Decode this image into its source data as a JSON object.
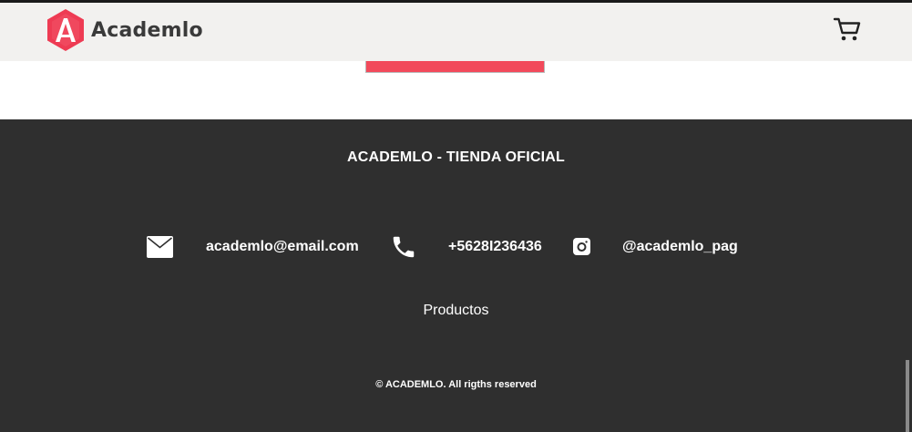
{
  "navbar": {
    "brand": "Academlo",
    "logo_icon": "academlo-logo-icon",
    "cart_icon": "cart-icon"
  },
  "colors": {
    "accent": "#f24a5b",
    "footer_bg": "#2f2f2f",
    "navbar_bg": "#f2f1ef"
  },
  "footer": {
    "title": "ACADEMLO - TIENDA OFICIAL",
    "contacts": [
      {
        "icon": "envelope-icon",
        "text": "academlo@email.com"
      },
      {
        "icon": "phone-icon",
        "text": "+5628I236436"
      },
      {
        "icon": "instagram-icon",
        "text": "@academlo_pag"
      }
    ],
    "link": "Productos",
    "copyright": "© ACADEMLO. All rigths reserved"
  }
}
